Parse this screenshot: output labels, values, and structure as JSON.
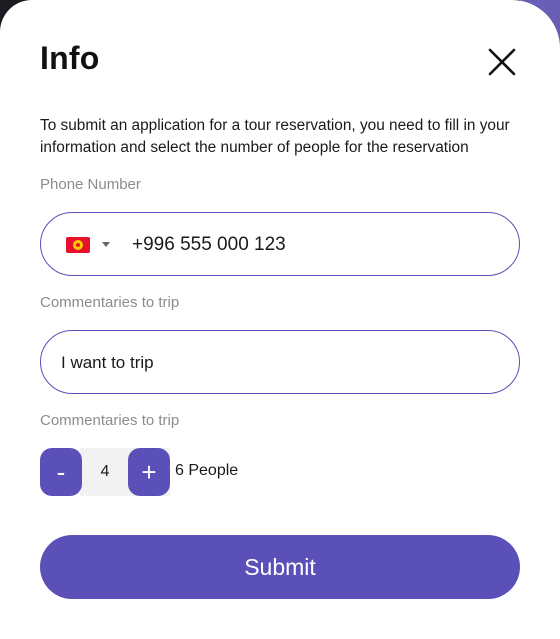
{
  "modal": {
    "title": "Info",
    "description": "To submit an application for a tour reservation, you need to fill in your information and select the number of people for the reservation"
  },
  "phone": {
    "label": "Phone Number",
    "country_flag": "kyrgyzstan-flag-icon",
    "value": "+996 555 000 123"
  },
  "comment": {
    "label": "Commentaries to trip",
    "value": "I want to trip"
  },
  "people": {
    "label": "Commentaries to trip",
    "minus_label": "-",
    "plus_label": "+",
    "count": "4",
    "summary": "6 People"
  },
  "submit": {
    "label": "Submit"
  },
  "colors": {
    "accent": "#5b50b8",
    "border": "#5b50b8",
    "label": "#8c8c8c"
  }
}
